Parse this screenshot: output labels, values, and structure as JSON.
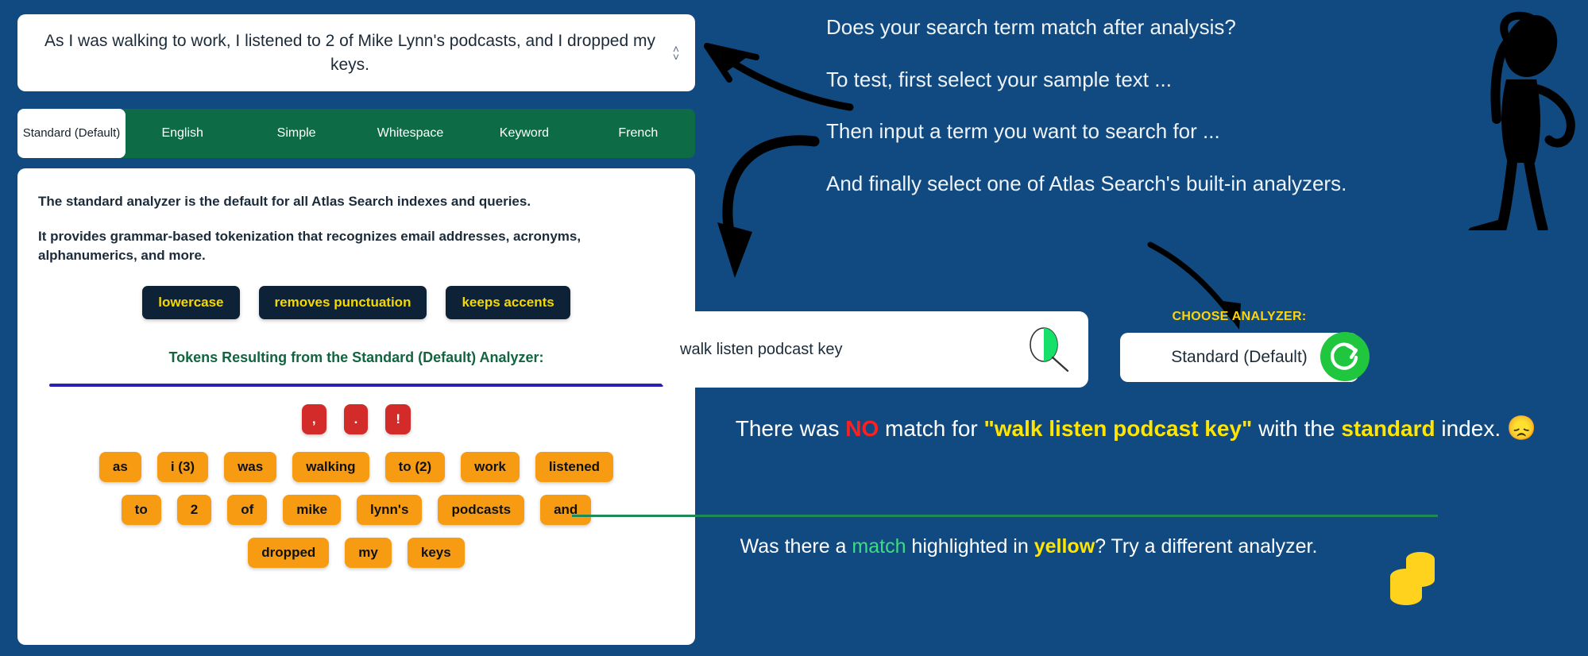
{
  "colors": {
    "background": "#114a80",
    "tabbar_green": "#0d6b46",
    "badge_navy": "#0d2137",
    "badge_yellow": "#f5d800",
    "chip_orange": "#f79c12",
    "chip_red": "#d32a2a",
    "heading_green": "#12653f",
    "divider_blue": "#2b1fb8",
    "refresh_green": "#21c63f",
    "accent_yellow": "#ffd400"
  },
  "sample": {
    "text": "As I was walking to work, I listened to 2 of Mike Lynn's podcasts, and I dropped my keys.",
    "stepper_up": "˄",
    "stepper_down": "˅"
  },
  "tabs": [
    {
      "label": "Standard (Default)",
      "active": true
    },
    {
      "label": "English",
      "active": false
    },
    {
      "label": "Simple",
      "active": false
    },
    {
      "label": "Whitespace",
      "active": false
    },
    {
      "label": "Keyword",
      "active": false
    },
    {
      "label": "French",
      "active": false
    }
  ],
  "analyzer_info": {
    "line1": "The standard analyzer is the default for all Atlas Search indexes and queries.",
    "line2": "It provides grammar-based tokenization that recognizes email addresses, acronyms, alphanumerics, and more.",
    "badges": [
      "lowercase",
      "removes punctuation",
      "keeps accents"
    ],
    "tokens_heading": "Tokens Resulting from the Standard (Default) Analyzer:"
  },
  "tokens": {
    "punctuation": [
      ",",
      ".",
      "!"
    ],
    "rows": [
      [
        "as",
        "i (3)",
        "was",
        "walking",
        "to (2)",
        "work",
        "listened"
      ],
      [
        "to",
        "2",
        "of",
        "mike",
        "lynn's",
        "podcasts",
        "and"
      ],
      [
        "dropped",
        "my",
        "keys"
      ]
    ]
  },
  "instructions": [
    "Does your search term match after analysis?",
    "To test, first select your sample text ...",
    "Then input a term you want to search for ...",
    "And finally select one of Atlas Search's built-in analyzers."
  ],
  "search": {
    "value": "walk listen podcast key",
    "placeholder": "walk listen podcast key",
    "icon": "magnifying-glass-icon"
  },
  "analyzer_select": {
    "label": "CHOOSE ANALYZER:",
    "value": "Standard (Default)",
    "options": [
      "Standard (Default)",
      "English",
      "Simple",
      "Whitespace",
      "Keyword",
      "French"
    ],
    "stepper_up": "˄",
    "stepper_down": "˅",
    "refresh_icon": "refresh-icon"
  },
  "result": {
    "prefix": "There was ",
    "no": "NO",
    "middle": " match for ",
    "term": "\"walk listen podcast key\"",
    "with_the": " with the ",
    "index_name": "standard",
    "suffix": " index.",
    "emoji": "😞"
  },
  "bottom": {
    "part1": "Was there a ",
    "match": "match",
    "part2": " highlighted in ",
    "yellow": "yellow",
    "part3": "? Try a different analyzer.",
    "coins_icon": "coins-icon"
  },
  "decor": {
    "stick_figure": "thinking-person-silhouette",
    "arrow_upleft": "arrow-up-left-icon",
    "arrow_down": "arrow-down-curved-icon",
    "arrow_diag": "arrow-down-right-icon"
  }
}
